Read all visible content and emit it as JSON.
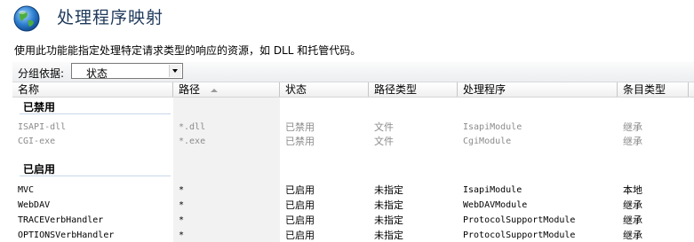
{
  "header": {
    "title": "处理程序映射",
    "icon": "globe-icon"
  },
  "description": "使用此功能能指定处理特定请求类型的响应的资源，如 DLL 和托管代码。",
  "toolbar": {
    "group_label": "分组依据:",
    "group_value": "状态"
  },
  "columns": [
    {
      "label": "名称"
    },
    {
      "label": "路径",
      "sorted": "ascending"
    },
    {
      "label": "状态"
    },
    {
      "label": "路径类型"
    },
    {
      "label": "处理程序"
    },
    {
      "label": "条目类型"
    }
  ],
  "groups": [
    {
      "title": "已禁用",
      "rows": [
        {
          "name": "ISAPI-dll",
          "path": "*.dll",
          "state": "已禁用",
          "path_type": "文件",
          "handler": "IsapiModule",
          "entry_type": "继承"
        },
        {
          "name": "CGI-exe",
          "path": "*.exe",
          "state": "已禁用",
          "path_type": "文件",
          "handler": "CgiModule",
          "entry_type": "继承"
        }
      ]
    },
    {
      "title": "已启用",
      "rows": [
        {
          "name": "MVC",
          "path": "*",
          "state": "已启用",
          "path_type": "未指定",
          "handler": "IsapiModule",
          "entry_type": "本地"
        },
        {
          "name": "WebDAV",
          "path": "*",
          "state": "已启用",
          "path_type": "未指定",
          "handler": "WebDAVModule",
          "entry_type": "继承"
        },
        {
          "name": "TRACEVerbHandler",
          "path": "*",
          "state": "已启用",
          "path_type": "未指定",
          "handler": "ProtocolSupportModule",
          "entry_type": "继承"
        },
        {
          "name": "OPTIONSVerbHandler",
          "path": "*",
          "state": "已启用",
          "path_type": "未指定",
          "handler": "ProtocolSupportModule",
          "entry_type": "继承"
        }
      ]
    }
  ],
  "colors": {
    "title": "#1e395b",
    "disabled_text": "#8b8b8b",
    "column_shade": "#f2f2f2"
  }
}
